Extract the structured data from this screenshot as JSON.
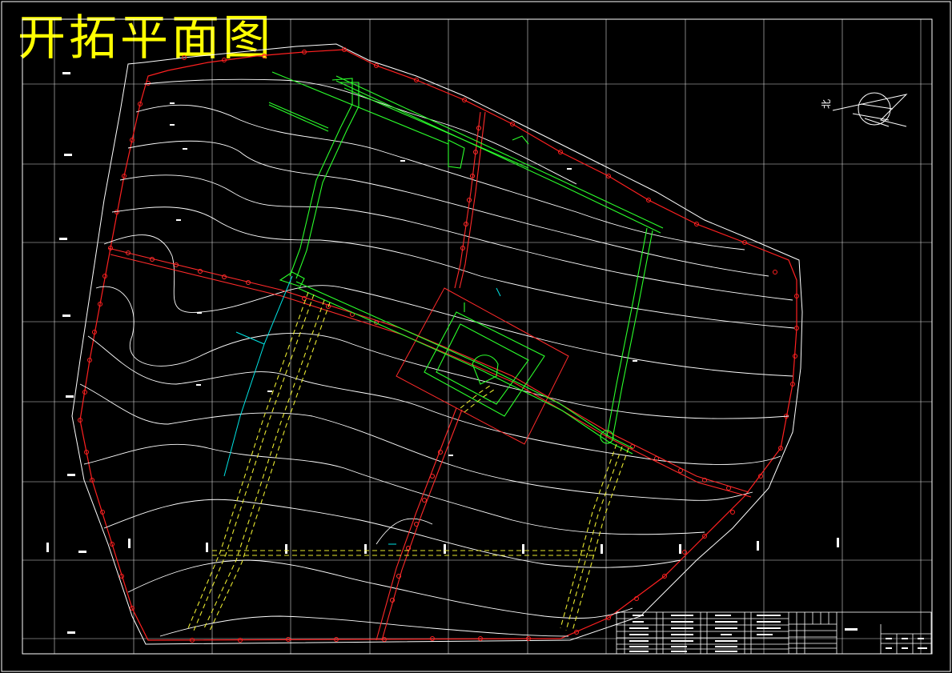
{
  "drawing": {
    "title": "开拓平面图",
    "background": "#000000",
    "colors": {
      "frame": "#ffffff",
      "grid": "#ffffff",
      "contour": "#ffffff",
      "boundary": "#ff2020",
      "main_roadway": "#ff2a2a",
      "development": "#2bff2b",
      "shaft_lines": "#e8e830",
      "cyan": "#00e5e5",
      "title": "#ffff00"
    },
    "north_arrow_label": "北"
  }
}
